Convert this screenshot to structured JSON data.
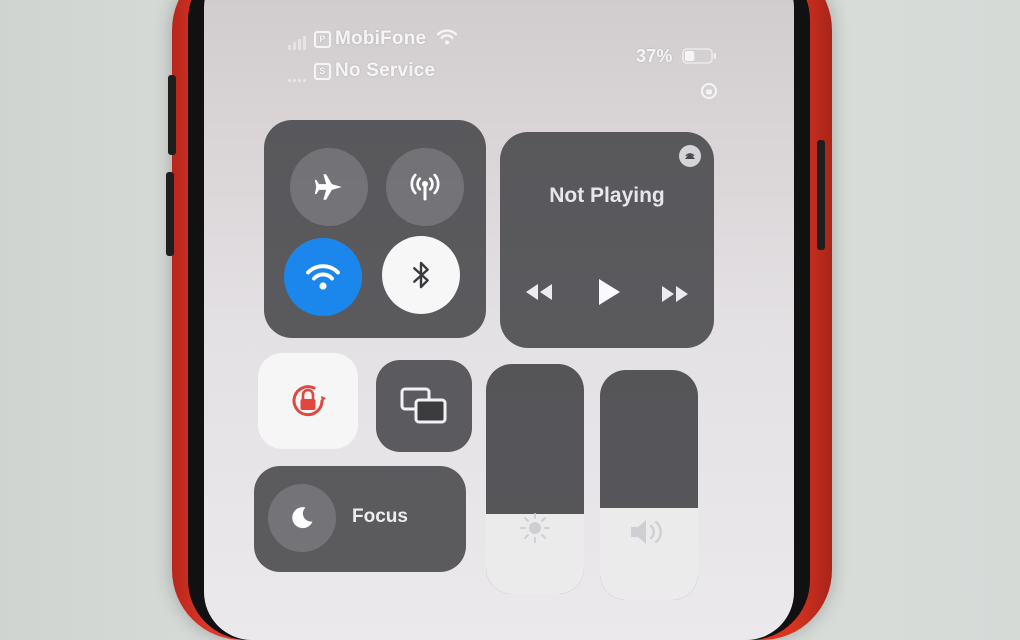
{
  "status_bar": {
    "carrier_primary": "MobiFone",
    "carrier_secondary": "No Service",
    "sim_primary_badge": "P",
    "sim_secondary_badge": "S",
    "battery_percent": "37%",
    "battery_level": 0.37,
    "icons": [
      "cellular-bars-icon",
      "wifi-icon",
      "battery-icon",
      "orientation-lock-indicator-icon"
    ]
  },
  "connectivity": {
    "airplane_mode": {
      "icon": "airplane-icon",
      "active": false
    },
    "cellular_data": {
      "icon": "antenna-icon",
      "active": false
    },
    "wifi": {
      "icon": "wifi-icon",
      "active": true
    },
    "bluetooth": {
      "icon": "bluetooth-icon",
      "active": true
    }
  },
  "now_playing": {
    "title": "Not Playing",
    "icons": [
      "airplay-icon",
      "rewind-icon",
      "play-icon",
      "fast-forward-icon"
    ]
  },
  "orientation_lock": {
    "icon": "orientation-lock-icon",
    "active": true,
    "accent": "#e0473f"
  },
  "screen_mirroring": {
    "icon": "screen-mirroring-icon"
  },
  "focus": {
    "label": "Focus",
    "icon": "moon-icon"
  },
  "brightness": {
    "icon": "sun-icon",
    "level": 0.35
  },
  "volume": {
    "icon": "speaker-icon",
    "level": 0.4
  },
  "colors": {
    "wifi_active": "#1b87ec",
    "case": "#d8341f"
  }
}
